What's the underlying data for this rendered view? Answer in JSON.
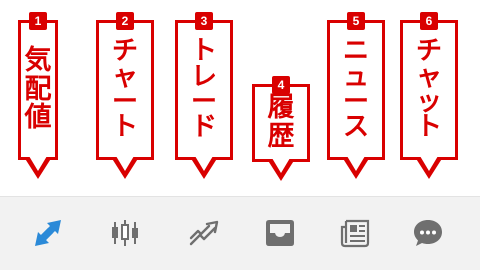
{
  "callouts": [
    {
      "number": "1",
      "label": "気\n配\n値"
    },
    {
      "number": "2",
      "label": "チ\nャ\nー\nト"
    },
    {
      "number": "3",
      "label": "ト\nレ\nー\nド"
    },
    {
      "number": "4",
      "label": "履\n歴"
    },
    {
      "number": "5",
      "label": "ニ\nュ\nー\nス"
    },
    {
      "number": "6",
      "label": "チ\nャ\nッ\nト"
    }
  ],
  "tabs": [
    {
      "icon": "double-arrow-icon",
      "active": true
    },
    {
      "icon": "candlestick-icon",
      "active": false
    },
    {
      "icon": "trend-arrow-icon",
      "active": false
    },
    {
      "icon": "inbox-tray-icon",
      "active": false
    },
    {
      "icon": "newspaper-icon",
      "active": false
    },
    {
      "icon": "chat-bubble-icon",
      "active": false
    }
  ],
  "colors": {
    "callout_red": "#d90000",
    "icon_active": "#2b8ad8",
    "icon_inactive": "#6f6f6f",
    "tabbar_bg": "#f2f2f2"
  }
}
